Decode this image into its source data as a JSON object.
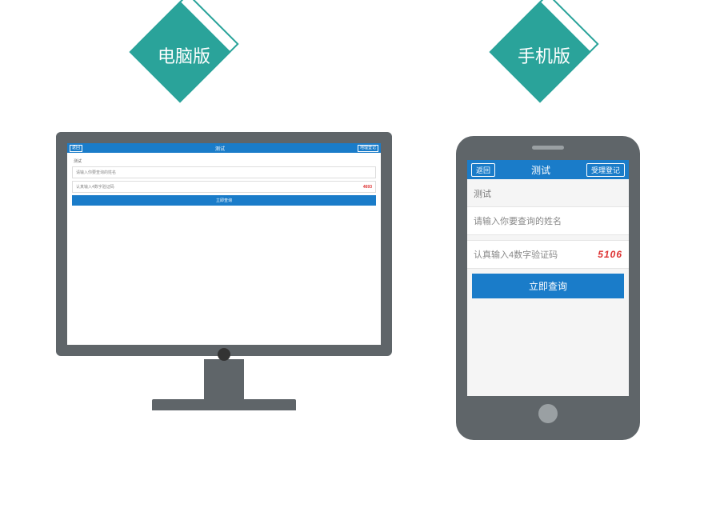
{
  "badges": {
    "desktop": "电脑版",
    "mobile": "手机版"
  },
  "desktop": {
    "header": {
      "back": "返回",
      "title": "测试",
      "admin": "地理登记"
    },
    "section_label": "测试",
    "name_placeholder": "请输入你要查询的姓名",
    "captcha_placeholder": "认真输入4数字验证码",
    "captcha_value": "4693",
    "submit": "立即查询"
  },
  "mobile": {
    "header": {
      "back": "返回",
      "title": "测试",
      "admin": "受理登记"
    },
    "section_label": "测试",
    "name_placeholder": "请输入你要查询的姓名",
    "captcha_placeholder": "认真输入4数字验证码",
    "captcha_value": "5106",
    "submit": "立即查询"
  }
}
